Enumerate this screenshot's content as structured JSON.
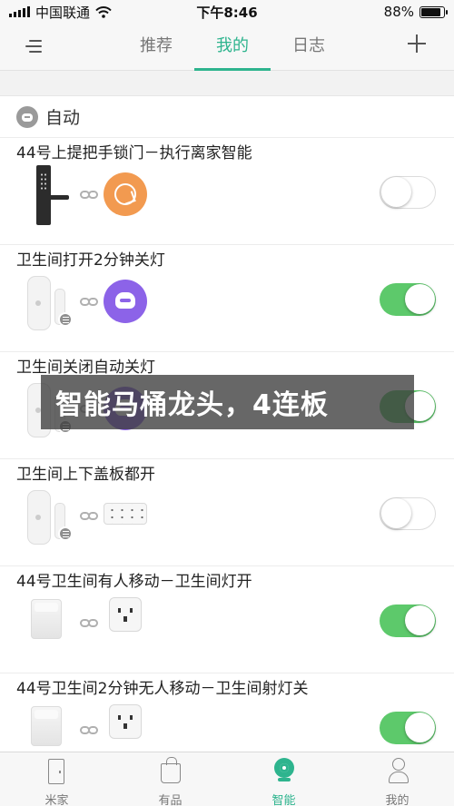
{
  "status_bar": {
    "carrier": "中国联通",
    "time": "下午8:46",
    "battery": "88%",
    "battery_level": 0.88
  },
  "nav": {
    "tabs": [
      {
        "label": "推荐",
        "active": false
      },
      {
        "label": "我的",
        "active": true
      },
      {
        "label": "日志",
        "active": false
      }
    ],
    "accent_color": "#2eb48e"
  },
  "section": {
    "title": "自动"
  },
  "automations": [
    {
      "title": "44号上提把手锁门－执行离家智能",
      "trigger": "door-lock",
      "action": "orange-scene",
      "enabled": false
    },
    {
      "title": "卫生间打开2分钟关灯",
      "trigger": "door-sensor",
      "action": "purple-bot",
      "enabled": true
    },
    {
      "title": "卫生间关闭自动关灯",
      "trigger": "door-sensor",
      "action": "purple-bot",
      "enabled": true
    },
    {
      "title": "卫生间上下盖板都开",
      "trigger": "door-sensor",
      "action": "power-strip",
      "enabled": false
    },
    {
      "title": "44号卫生间有人移动－卫生间灯开",
      "trigger": "motion-sensor",
      "action": "wall-outlet",
      "enabled": true
    },
    {
      "title": "44号卫生间2分钟无人移动－卫生间射灯关",
      "trigger": "motion-sensor",
      "action": "wall-outlet",
      "enabled": true
    }
  ],
  "overlay": {
    "text": "智能马桶龙头，4连板"
  },
  "tab_bar": {
    "items": [
      {
        "label": "米家",
        "active": false
      },
      {
        "label": "有品",
        "active": false
      },
      {
        "label": "智能",
        "active": true
      },
      {
        "label": "我的",
        "active": false
      }
    ]
  },
  "colors": {
    "toggle_on": "#5dc96b",
    "scene_orange": "#f29a50",
    "bot_purple": "#8c63e8"
  }
}
